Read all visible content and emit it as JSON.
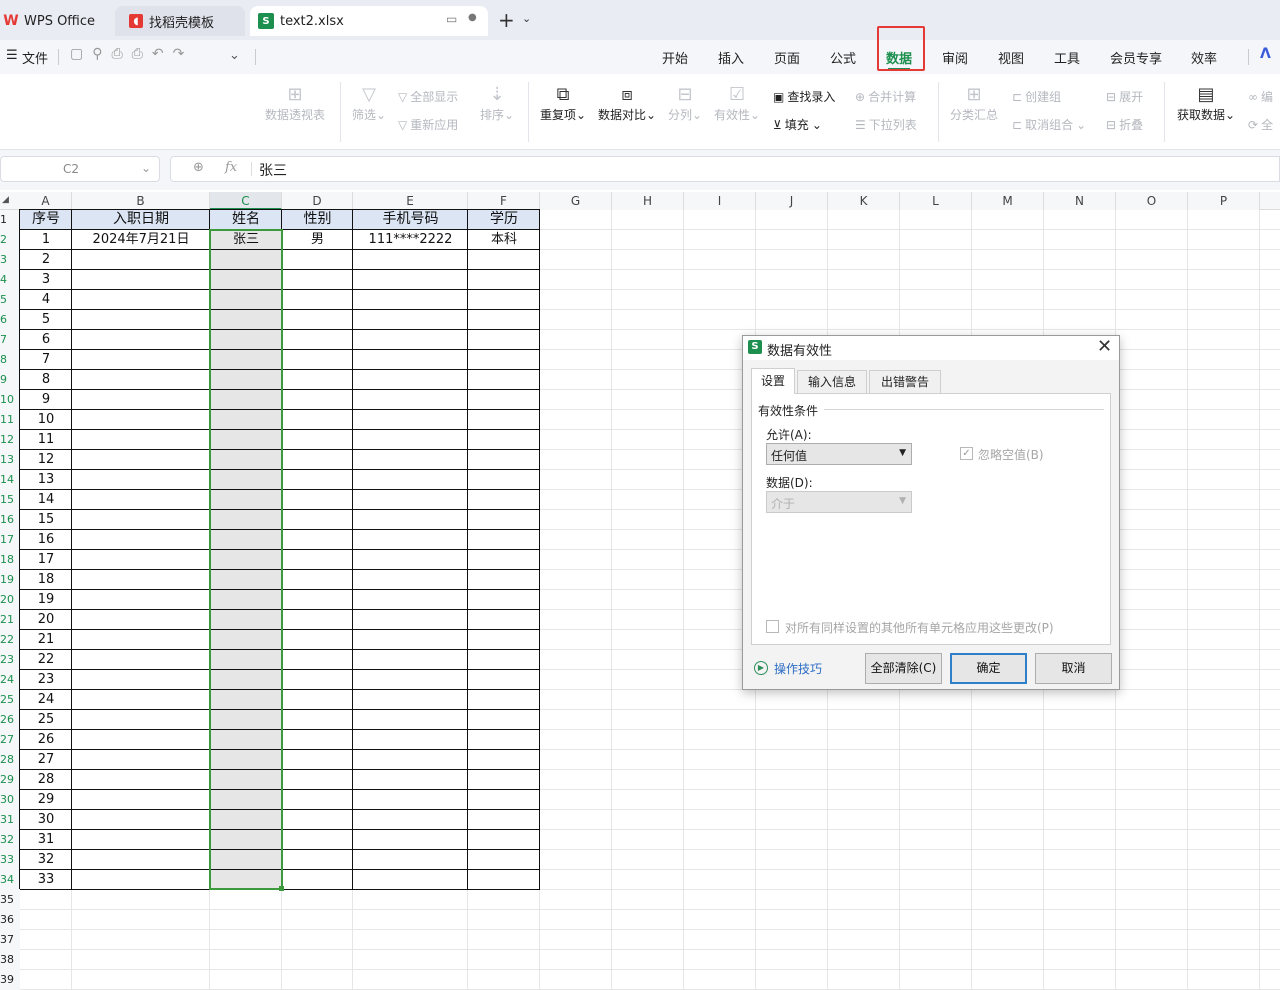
{
  "tabs": [
    {
      "name": "tab-wps-office",
      "label": "WPS Office"
    },
    {
      "name": "tab-template",
      "label": "找稻壳模板"
    },
    {
      "name": "tab-text2",
      "label": "text2.xlsx"
    }
  ],
  "menu": {
    "file": "文件",
    "items": [
      "开始",
      "插入",
      "页面",
      "公式",
      "数据",
      "审阅",
      "视图",
      "工具",
      "会员专享",
      "效率"
    ],
    "active": "数据"
  },
  "ribbon": {
    "pivot": "数据透视表",
    "filter": "筛选",
    "show_all": "全部显示",
    "reapply": "重新应用",
    "sort": "排序",
    "duplicates": "重复项",
    "compare": "数据对比",
    "split": "分列",
    "validity": "有效性",
    "find_entry": "查找录入",
    "fill": "填充",
    "merge_calc": "合并计算",
    "dropdown": "下拉列表",
    "subtotal": "分类汇总",
    "group": "创建组",
    "ungroup": "取消组合",
    "expand": "展开",
    "collapse": "折叠",
    "get_data": "获取数据",
    "edit_trunc": "编",
    "all_trunc": "全"
  },
  "formula_bar": {
    "cell_ref": "C2",
    "fx": "fx",
    "value": "张三"
  },
  "sheet": {
    "columns": [
      "A",
      "B",
      "C",
      "D",
      "E",
      "F",
      "G",
      "H",
      "I",
      "J",
      "K",
      "L",
      "M",
      "N",
      "O",
      "P"
    ],
    "headers": [
      "序号",
      "入职日期",
      "姓名",
      "性别",
      "手机号码",
      "学历"
    ],
    "first_row": [
      "1",
      "2024年7月21日",
      "张三",
      "男",
      "111****2222",
      "本科"
    ],
    "seq": [
      "2",
      "3",
      "4",
      "5",
      "6",
      "7",
      "8",
      "9",
      "10",
      "11",
      "12",
      "13",
      "14",
      "15",
      "16",
      "17",
      "18",
      "19",
      "20",
      "21",
      "22",
      "23",
      "24",
      "25",
      "26",
      "27",
      "28",
      "29",
      "30",
      "31",
      "32",
      "33"
    ],
    "row_numbers": [
      "1",
      "2",
      "3",
      "4",
      "5",
      "6",
      "7",
      "8",
      "9",
      "10",
      "11",
      "12",
      "13",
      "14",
      "15",
      "16",
      "17",
      "18",
      "19",
      "20",
      "21",
      "22",
      "23",
      "24",
      "25",
      "26",
      "27",
      "28",
      "29",
      "30",
      "31",
      "32",
      "33",
      "34",
      "35",
      "36",
      "37",
      "38",
      "39"
    ]
  },
  "dialog": {
    "title": "数据有效性",
    "tabs": [
      "设置",
      "输入信息",
      "出错警告"
    ],
    "group_title": "有效性条件",
    "allow_label": "允许(A):",
    "allow_value": "任何值",
    "ignore_blank": "忽略空值(B)",
    "data_label": "数据(D):",
    "data_value": "介于",
    "apply_all": "对所有同样设置的其他所有单元格应用这些更改(P)",
    "tips": "操作技巧",
    "clear_all": "全部清除(C)",
    "ok": "确定",
    "cancel": "取消"
  },
  "colors": {
    "accent": "#1d8f4e",
    "highlight": "#e53935",
    "header_fill": "#dbe5f4",
    "selection": "#e6e6e6"
  }
}
